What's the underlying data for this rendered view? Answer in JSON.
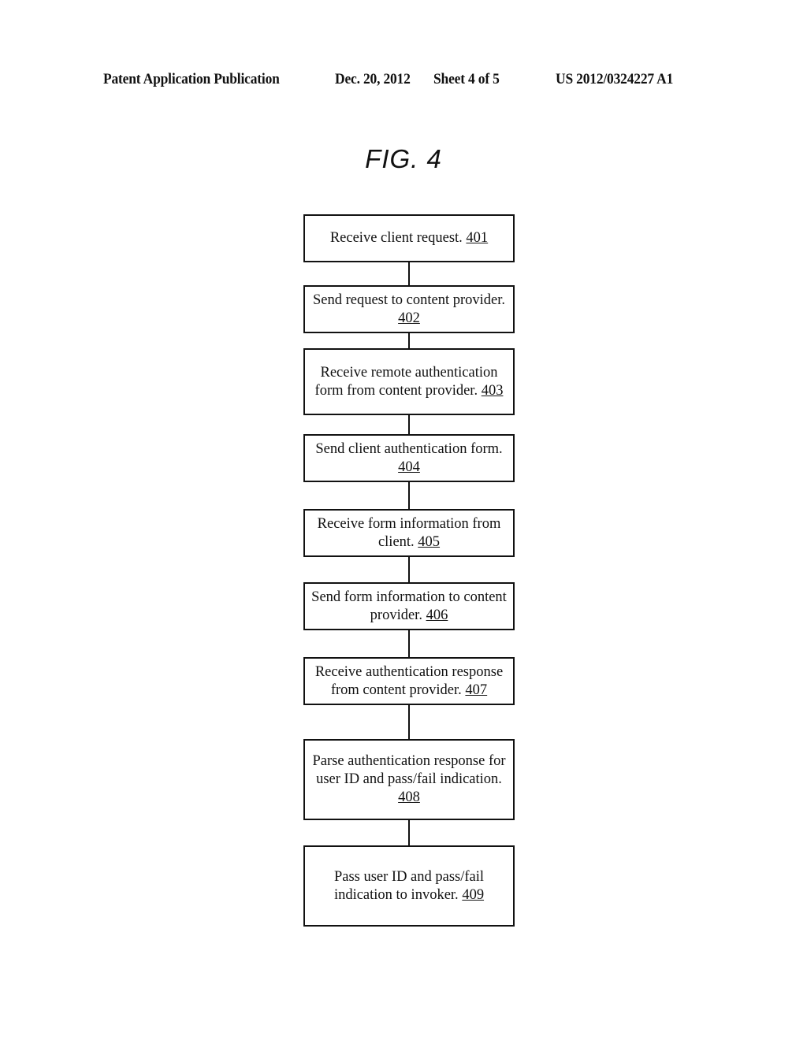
{
  "header": {
    "publication_type": "Patent Application Publication",
    "date": "Dec. 20, 2012",
    "sheet": "Sheet 4 of 5",
    "publication_number": "US 2012/0324227 A1"
  },
  "figure": {
    "title": "FIG. 4",
    "steps": [
      {
        "text": "Receive client request.",
        "ref": "401"
      },
      {
        "text": "Send request to content provider.",
        "ref": "402"
      },
      {
        "text": "Receive remote authentication form from content provider.",
        "ref": "403"
      },
      {
        "text": "Send client authentication form.",
        "ref": "404"
      },
      {
        "text": "Receive form information from client.",
        "ref": "405"
      },
      {
        "text": "Send form information to content provider.",
        "ref": "406"
      },
      {
        "text": "Receive authentication response from content provider.",
        "ref": "407"
      },
      {
        "text": "Parse authentication response for user ID and pass/fail indication.",
        "ref": "408"
      },
      {
        "text": "Pass user ID and pass/fail indication to invoker.",
        "ref": "409"
      }
    ],
    "connections": [
      {
        "from": "401",
        "to": "402"
      },
      {
        "from": "402",
        "to": "403"
      },
      {
        "from": "403",
        "to": "404"
      },
      {
        "from": "404",
        "to": "405"
      },
      {
        "from": "405",
        "to": "406"
      },
      {
        "from": "406",
        "to": "407"
      },
      {
        "from": "407",
        "to": "408"
      },
      {
        "from": "408",
        "to": "409"
      }
    ]
  }
}
